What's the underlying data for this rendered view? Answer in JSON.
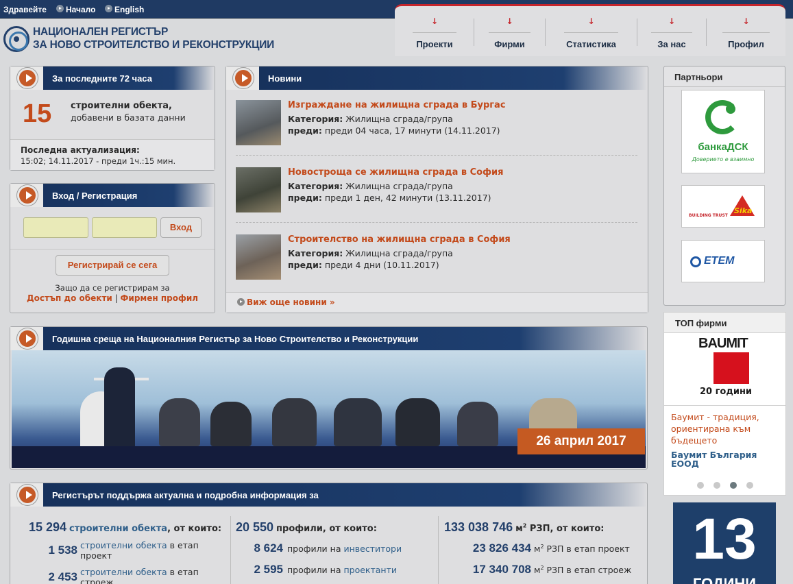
{
  "topbar": {
    "greeting": "Здравейте",
    "home": "Начало",
    "english": "English"
  },
  "logo": {
    "line1": "НАЦИОНАЛЕН РЕГИСТЪР",
    "line2": "ЗА НОВО СТРОИТЕЛСТВО И РЕКОНСТРУКЦИИ"
  },
  "nav": [
    {
      "label": "Проекти"
    },
    {
      "label": "Фирми"
    },
    {
      "label": "Статистика"
    },
    {
      "label": "За нас"
    },
    {
      "label": "Профил"
    }
  ],
  "last72": {
    "title": "За последните 72 часа",
    "count": "15",
    "text1": "строителни обекта,",
    "text2": "добавени в базата данни",
    "update_label": "Последна актуализация:",
    "update_value": "15:02; 14.11.2017 - преди 1ч.:15 мин."
  },
  "login": {
    "title": "Вход / Регистрация",
    "login_button": "Вход",
    "register_button": "Регистрирай се сега",
    "why": "Защо да се регистрирам за",
    "link1": "Достъп до обекти",
    "sep": "|",
    "link2": "Фирмен профил"
  },
  "news": {
    "title": "Новини",
    "cat_label": "Категория:",
    "ago_label": "преди:",
    "items": [
      {
        "title": "Изграждане на жилищна сграда в Бургас",
        "category": "Жилищна сграда/група",
        "ago": "преди 04 часа, 17 минути (14.11.2017)"
      },
      {
        "title": "Новостроща се жилищна сграда в София",
        "category": "Жилищна сграда/група",
        "ago": "преди 1 ден, 42 минути (13.11.2017)"
      },
      {
        "title": "Строителство на жилищна сграда в София",
        "category": "Жилищна сграда/група",
        "ago": "преди 4 дни (10.11.2017)"
      }
    ],
    "more": "Виж още новини »"
  },
  "event": {
    "title": "Годишна среща на Националния Регистър за Ново Строителство и Реконструкции",
    "date": "26 април 2017"
  },
  "partners": {
    "title": "Партньори",
    "dsk_name": "банкаДСК",
    "dsk_slogan": "Доверието е взаимно",
    "sika_trust": "BUILDING TRUST",
    "sika": "Sika",
    "etem": "ETEM"
  },
  "top": {
    "title": "ТОП фирми",
    "logo_text": "BAUMIT",
    "logo_years": "20 години",
    "desc": "Баумит - традиция, ориентирана към бъдещето",
    "company": "Баумит България ЕООД",
    "active_dot": 3
  },
  "anniv": {
    "number": "13",
    "word": "ГОДИНИ"
  },
  "stats": {
    "title": "Регистърът поддържа актуална и подробна информация за",
    "col1": {
      "total": "15 294",
      "total_link": "строителни обекта",
      "total_suffix": ", от които:",
      "rows": [
        {
          "num": "1 538",
          "link": "строителни обекта",
          "text1": " в етап",
          "text2": "проект"
        },
        {
          "num": "2 453",
          "link": "строителни обекта",
          "text1": " в етап",
          "text2": "строеж"
        }
      ]
    },
    "col2": {
      "total": "20 550",
      "total_suffix": "профили, от които:",
      "rows": [
        {
          "num": "8 624",
          "text": "профили на ",
          "link": "инвеститори"
        },
        {
          "num": "2 595",
          "text": "профили на ",
          "link": "проектанти"
        }
      ]
    },
    "col3": {
      "total": "133 038 746",
      "unit": "м",
      "sup": "2",
      "total_suffix": " РЗП, от които:",
      "rows": [
        {
          "num": "23 826 434",
          "text": " РЗП в етап проект"
        },
        {
          "num": "17 340 708",
          "text": " РЗП в етап строеж"
        }
      ]
    }
  }
}
